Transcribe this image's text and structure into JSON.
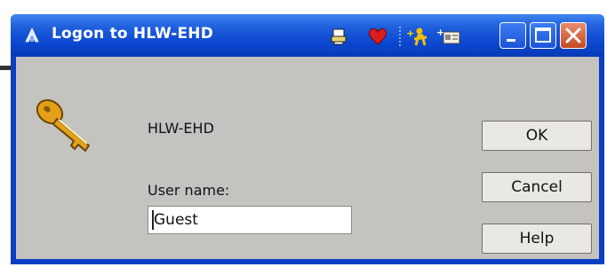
{
  "window": {
    "title": "Logon to HLW-EHD",
    "controls": [
      "minimize-icon",
      "maximize-icon",
      "close-icon"
    ],
    "toolbar_icons": [
      "printer-icon",
      "heart-icon",
      "add-user-icon",
      "add-card-icon"
    ]
  },
  "dialog": {
    "host": "HLW-EHD",
    "username_label": "User name:",
    "username_value": "Guest",
    "buttons": {
      "ok": "OK",
      "cancel": "Cancel",
      "help": "Help"
    }
  },
  "colors": {
    "titlebar": "#1f5fdc",
    "client": "#c5c3c0",
    "close": "#c24a24",
    "key": "#e3a019"
  }
}
